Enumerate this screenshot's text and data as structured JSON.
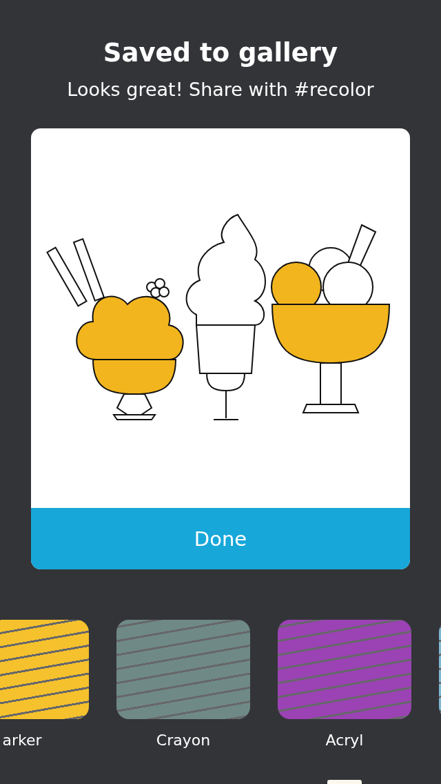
{
  "dialog": {
    "title": "Saved to gallery",
    "subtitle": "Looks great! Share with #recolor",
    "button": "Done"
  },
  "brushes": [
    {
      "label": "arker",
      "color": "#f5c12c"
    },
    {
      "label": "Crayon",
      "color": "#6f8a86"
    },
    {
      "label": "Acryl",
      "color": "#9b42b4"
    },
    {
      "color": "#7fb8d6"
    }
  ]
}
